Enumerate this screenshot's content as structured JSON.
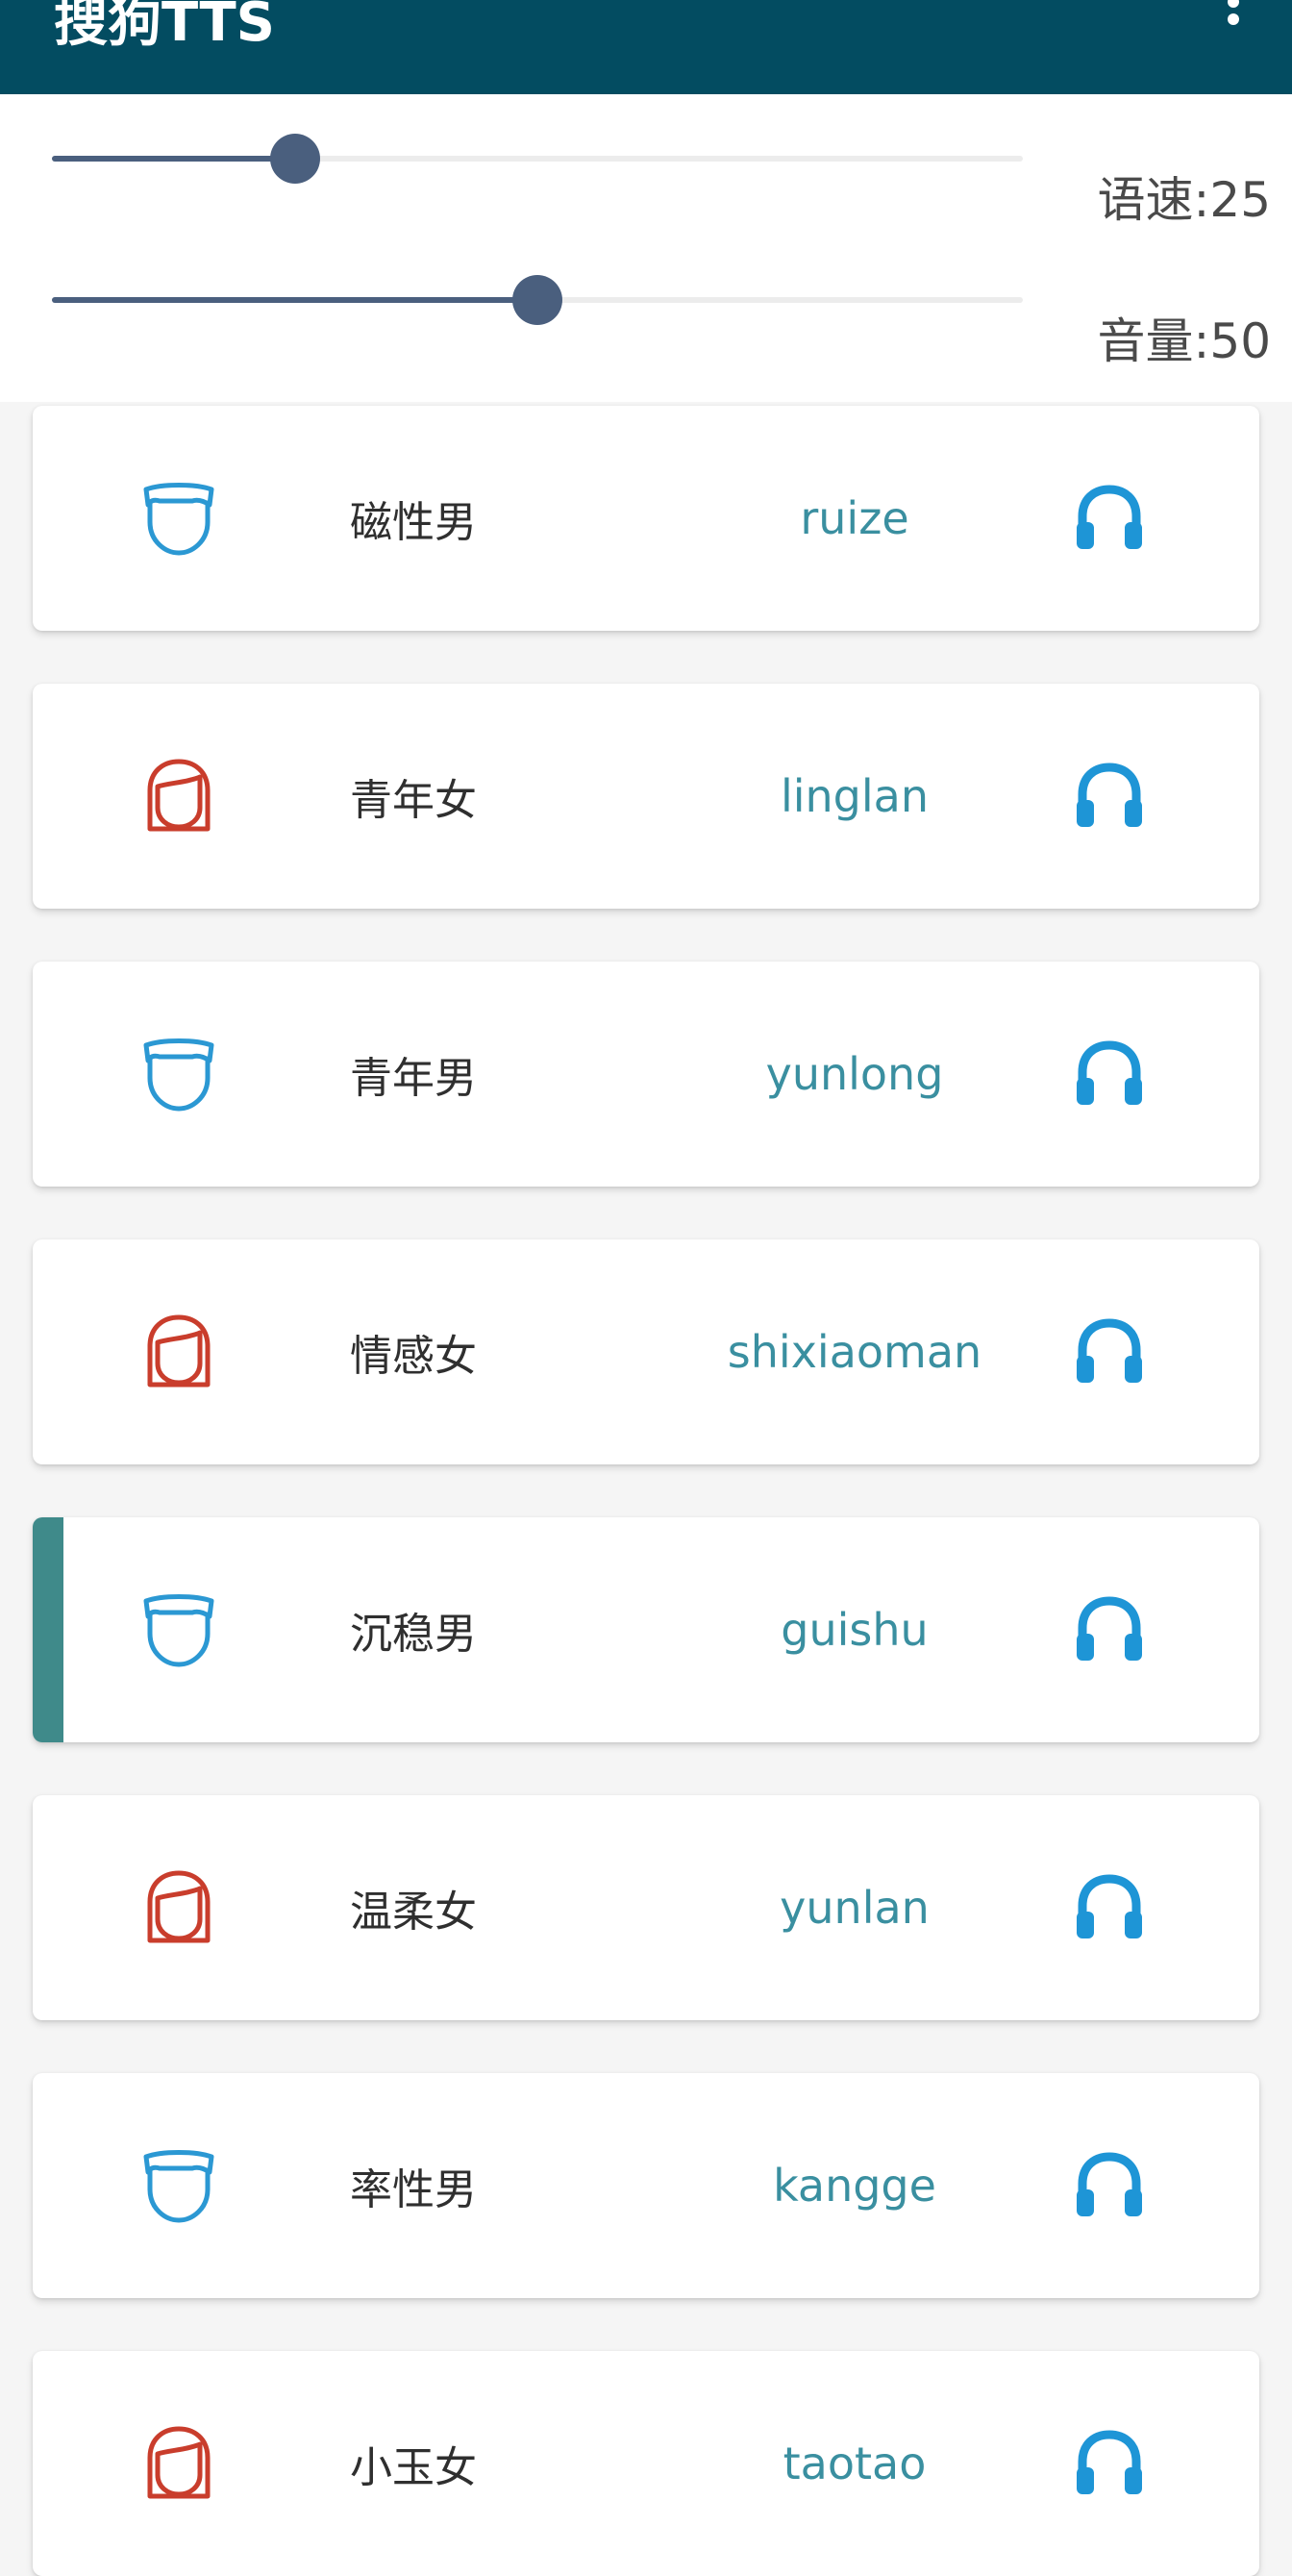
{
  "app": {
    "title": "搜狗TTS",
    "menu_icon": "more-vertical-icon",
    "bar_color": "#034c61"
  },
  "controls": {
    "speed": {
      "label": "语速:25",
      "value": 25,
      "fraction": 0.25
    },
    "volume": {
      "label": "音量:50",
      "value": 50,
      "fraction": 0.5
    },
    "slider_color": "#4a5f7e"
  },
  "voices": [
    {
      "gender": "male",
      "icon": "male-face-icon",
      "label": "磁性男",
      "id": "ruize",
      "selected": false
    },
    {
      "gender": "female",
      "icon": "female-face-icon",
      "label": "青年女",
      "id": "linglan",
      "selected": false
    },
    {
      "gender": "male",
      "icon": "male-face-icon",
      "label": "青年男",
      "id": "yunlong",
      "selected": false
    },
    {
      "gender": "female",
      "icon": "female-face-icon",
      "label": "情感女",
      "id": "shixiaoman",
      "selected": false
    },
    {
      "gender": "male",
      "icon": "male-face-icon",
      "label": "沉稳男",
      "id": "guishu",
      "selected": true
    },
    {
      "gender": "female",
      "icon": "female-face-icon",
      "label": "温柔女",
      "id": "yunlan",
      "selected": false
    },
    {
      "gender": "male",
      "icon": "male-face-icon",
      "label": "率性男",
      "id": "kangge",
      "selected": false
    },
    {
      "gender": "female",
      "icon": "female-face-icon",
      "label": "小玉女",
      "id": "taotao",
      "selected": false
    }
  ],
  "colors": {
    "male_icon": "#2b98d3",
    "female_icon": "#c93d2c",
    "headphone_icon": "#1e95d6",
    "selected_marker": "#3f8a8a",
    "voice_id_text": "#3a8fa0"
  }
}
